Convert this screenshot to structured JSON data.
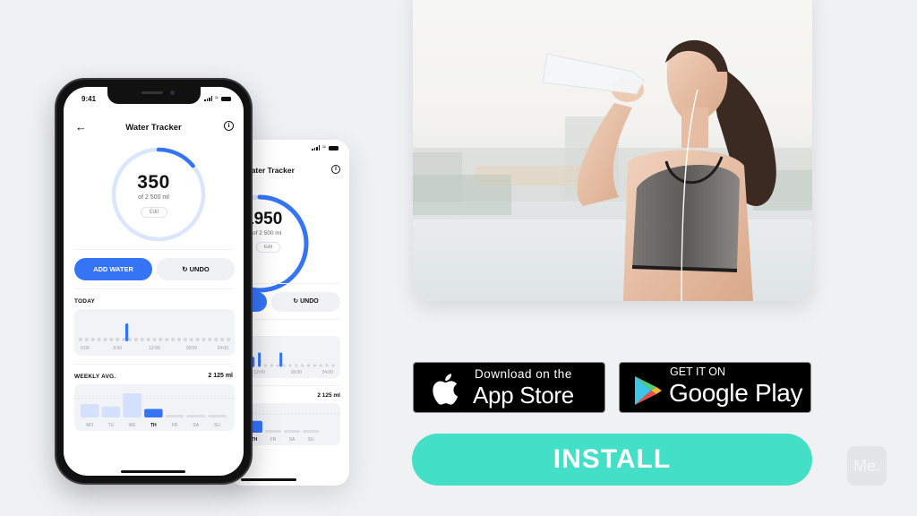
{
  "colors": {
    "background": "#f0f1f3",
    "accent_blue": "#3574f5",
    "ring_track": "#dbe6fd",
    "install_teal": "#43dfc6",
    "card_gray": "#f2f3f6"
  },
  "front_phone": {
    "status_time": "9:41",
    "title": "Water Tracker",
    "back_icon": "arrow-left-icon",
    "info_icon": "info-icon",
    "intake_value": "350",
    "intake_goal": "of 2 500 ml",
    "intake_progress": 0.14,
    "edit_label": "Edit",
    "add_water_label": "ADD WATER",
    "undo_label": "UNDO",
    "today_label": "TODAY",
    "today_ticks": [
      "0:00",
      "6:00",
      "12:00",
      "18:00",
      "24:00"
    ],
    "today_events": [
      {
        "hour": 7.5,
        "amount": 350
      }
    ],
    "weekly_label": "WEEKLY AVG.",
    "weekly_value": "2 125 ml",
    "weekly_days": [
      "MO",
      "TU",
      "WE",
      "TH",
      "FR",
      "SA",
      "SU"
    ],
    "weekly_levels": [
      0.55,
      0.45,
      1.0,
      0.35,
      0,
      0,
      0
    ],
    "weekly_active_day": "TH",
    "weekly_goal_level": 0.8
  },
  "back_phone": {
    "title": "Water Tracker",
    "intake_value": "1950",
    "intake_goal": "of 2 500 ml",
    "intake_progress": 0.78,
    "edit_label": "Edit",
    "undo_label": "UNDO",
    "today_ticks": [
      "12:00",
      "18:00",
      "24:00"
    ],
    "today_events": [
      {
        "hour": 10,
        "level": 1.0
      },
      {
        "hour": 11,
        "level": 0.55
      },
      {
        "hour": 12,
        "level": 0.8
      },
      {
        "hour": 15.5,
        "level": 0.8
      }
    ],
    "weekly_value": "2 125 ml",
    "weekly_days": [
      "TH",
      "FR",
      "SA",
      "SU"
    ],
    "weekly_levels": [
      0.55,
      0,
      0,
      0
    ],
    "weekly_active_day": "TH"
  },
  "photo": {
    "description": "Woman in sports bra drinking water from a plastic bottle outdoors, river and city in background"
  },
  "store_badges": {
    "apple": {
      "small": "Download on the",
      "big": "App Store"
    },
    "google": {
      "small": "GET IT ON",
      "big": "Google Play"
    }
  },
  "install_label": "INSTALL",
  "logo_text": "Me."
}
